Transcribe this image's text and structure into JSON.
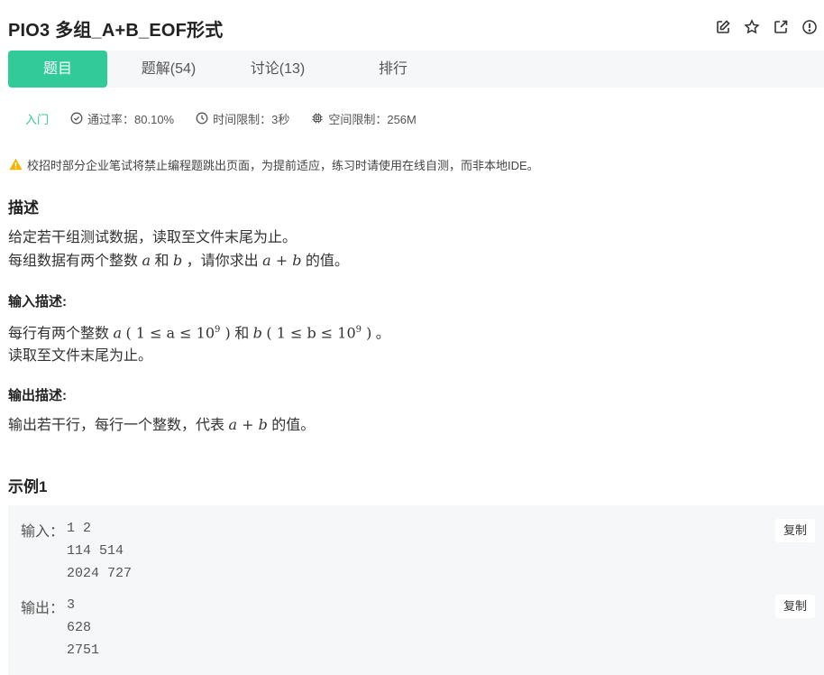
{
  "header": {
    "title": "PIO3  多组_A+B_EOF形式",
    "icons": [
      "edit-icon",
      "star-icon",
      "external-link-icon",
      "info-icon"
    ]
  },
  "tabs": [
    {
      "label": "题目",
      "active": true
    },
    {
      "label": "题解(54)",
      "active": false
    },
    {
      "label": "讨论(13)",
      "active": false
    },
    {
      "label": "排行",
      "active": false
    }
  ],
  "meta": {
    "difficulty": "入门",
    "pass_rate": "通过率：80.10%",
    "time_limit": "时间限制：3秒",
    "space_limit": "空间限制：256M"
  },
  "notice": "校招时部分企业笔试将禁止编程题跳出页面，为提前适应，练习时请使用在线自测，而非本地IDE。",
  "description": {
    "heading": "描述",
    "line1": "给定若干组测试数据，读取至文件末尾为止。",
    "line2_pre": "每组数据有两个整数",
    "line2_a": "a",
    "line2_mid": "和",
    "line2_b": "b",
    "line2_post": "，请你求出",
    "line2_expr": "a + b",
    "line2_end": "的值。"
  },
  "input_desc": {
    "heading": "输入描述:",
    "line1_pre": "每行有两个整数",
    "var_a": "a",
    "range_a": "( 1 ≤ a ≤ 10",
    "exp": "9",
    "close": " )",
    "mid": "和",
    "var_b": "b",
    "range_b": "( 1 ≤ b ≤ 10",
    "end": "。",
    "line2": "读取至文件末尾为止。"
  },
  "output_desc": {
    "heading": "输出描述:",
    "line_pre": "输出若干行，每行一个整数，代表",
    "expr": "a + b",
    "line_end": "的值。"
  },
  "example": {
    "heading": "示例1",
    "input_label": "输入：",
    "input_lines": [
      "1 2",
      "114 514",
      "2024 727"
    ],
    "output_label": "输出：",
    "output_lines": [
      "3",
      "628",
      "2751"
    ],
    "copy_label": "复制"
  },
  "colors": {
    "accent": "#32ca99",
    "warning": "#f5b400"
  }
}
